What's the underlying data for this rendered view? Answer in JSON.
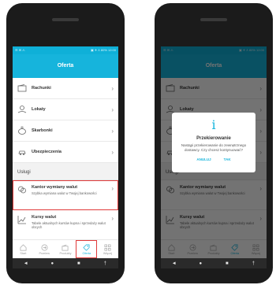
{
  "colors": {
    "brand": "#16b4dc",
    "highlight": "#e03a3a"
  },
  "status_bar": {
    "left": "☰ ✉ ⚠",
    "right": "▣ ✈ ⅄ 80% 12:00"
  },
  "header": {
    "title": "Oferta"
  },
  "menu": [
    {
      "label": "Rachunki",
      "icon": "wallet-icon"
    },
    {
      "label": "Lokaty",
      "icon": "coins-hand-icon"
    },
    {
      "label": "Skarbonki",
      "icon": "piggy-bank-icon"
    },
    {
      "label": "Ubezpieczenia",
      "icon": "car-shield-icon"
    }
  ],
  "section": {
    "title": "Usługi"
  },
  "services": [
    {
      "title": "Kantor wymiany walut",
      "subtitle": "Szybka wymiana walut w Twojej bankowości",
      "icon": "currency-exchange-icon"
    },
    {
      "title": "Kursy walut",
      "subtitle": "Tabele aktualnych kursów kupna i sprzedaży walut obcych",
      "icon": "chart-icon"
    }
  ],
  "tabs": [
    {
      "label": "Start",
      "icon": "home-icon"
    },
    {
      "label": "Przelew",
      "icon": "transfer-icon"
    },
    {
      "label": "Produkty",
      "icon": "wallet-icon"
    },
    {
      "label": "Oferta",
      "icon": "tag-icon"
    },
    {
      "label": "Więcej",
      "icon": "grid-icon"
    }
  ],
  "nav": {
    "back": "◄",
    "home": "●",
    "recent": "■",
    "extra": "†"
  },
  "dialog": {
    "icon": "i",
    "title": "Przekierowanie",
    "body": "Nastąpi przekierowanie do zewnętrznego dostawcy. Czy chcesz kontynuować?",
    "cancel": "ANULUJ",
    "confirm": "TAK"
  }
}
